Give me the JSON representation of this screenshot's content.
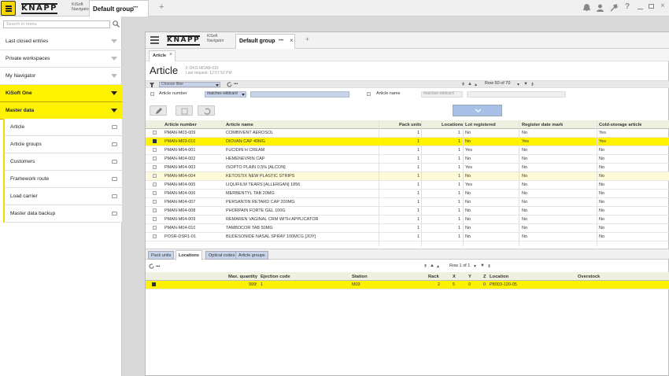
{
  "app": {
    "logo": "KNAPP",
    "product": "KiSoft",
    "product_sub": "Navigator",
    "tab_title": "Default group",
    "tab_more": "•••",
    "add_tab": "+"
  },
  "sidebar": {
    "search_placeholder": "Search in menu",
    "items": [
      {
        "label": "Last closed entries"
      },
      {
        "label": "Private workspaces"
      },
      {
        "label": "My Navigator"
      },
      {
        "label": "KiSoft One"
      },
      {
        "label": "Master data"
      }
    ],
    "children": [
      {
        "label": "Article"
      },
      {
        "label": "Article groups"
      },
      {
        "label": "Customers"
      },
      {
        "label": "Framework route"
      },
      {
        "label": "Load carrier"
      },
      {
        "label": "Master data backup"
      }
    ]
  },
  "inner": {
    "logo": "KNAPP",
    "product": "KiSoft",
    "product_sub": "Navigator",
    "tab_title": "Default group",
    "tab_more": "•••",
    "tab_close": "×",
    "add_tab": "+",
    "subtab": "Article",
    "subtab_close": "×",
    "page_title": "Article",
    "page_code": "F-DKG-MDAB-015",
    "last_request": "Last request: 12:57:52 PM",
    "filter_placeholder": "Choose filter",
    "more": "•••",
    "pager": "Row 50 of 70",
    "filter1_label": "Article number",
    "filter1_op": "matches wildcard",
    "filter2_label": "Article name",
    "filter2_op": "matches wildcard"
  },
  "table": {
    "headers": [
      "Article number",
      "Article name",
      "Pack units",
      "Locations",
      "Lot registered",
      "Register date mark",
      "Cold-storage article"
    ],
    "rows": [
      {
        "num": "PMAN-M03-009",
        "name": "COMBIVENT AEROSOL",
        "pack": "1",
        "loc": "1",
        "lot": "No",
        "reg": "No",
        "cold": "Yes",
        "checked": false,
        "style": ""
      },
      {
        "num": "PMAN-M03-010",
        "name": "DIOVAN CAP 40MG",
        "pack": "1",
        "loc": "1",
        "lot": "No",
        "reg": "Yes",
        "cold": "Yes",
        "checked": true,
        "style": "sel"
      },
      {
        "num": "PMAN-M04-001",
        "name": "FUCIDIN H CREAM",
        "pack": "1",
        "loc": "1",
        "lot": "Yes",
        "reg": "No",
        "cold": "No",
        "checked": false,
        "style": ""
      },
      {
        "num": "PMAN-M04-002",
        "name": "HEMENEVRIN CAP",
        "pack": "1",
        "loc": "1",
        "lot": "No",
        "reg": "No",
        "cold": "No",
        "checked": false,
        "style": ""
      },
      {
        "num": "PMAN-M04-003",
        "name": "ISOPTO PLAIN 0.5% [ALCON]",
        "pack": "1",
        "loc": "1",
        "lot": "Yes",
        "reg": "No",
        "cold": "No",
        "checked": false,
        "style": ""
      },
      {
        "num": "PMAN-M04-004",
        "name": "KETOSTIX NEW PLASTIC STRIPS",
        "pack": "1",
        "loc": "1",
        "lot": "No",
        "reg": "No",
        "cold": "No",
        "checked": false,
        "style": "lt"
      },
      {
        "num": "PMAN-M04-005",
        "name": "LIQUIFILM TEARS [ALLERGAN] 1856",
        "pack": "1",
        "loc": "1",
        "lot": "Yes",
        "reg": "No",
        "cold": "No",
        "checked": false,
        "style": ""
      },
      {
        "num": "PMAN-M04-006",
        "name": "MERBENTYL TAB 20MG",
        "pack": "1",
        "loc": "1",
        "lot": "No",
        "reg": "No",
        "cold": "No",
        "checked": false,
        "style": ""
      },
      {
        "num": "PMAN-M04-007",
        "name": "PERSANTIN RETARD CAP 200MG",
        "pack": "1",
        "loc": "1",
        "lot": "No",
        "reg": "No",
        "cold": "No",
        "checked": false,
        "style": ""
      },
      {
        "num": "PMAN-M04-008",
        "name": "PHORPAIN FORTE GEL 100G",
        "pack": "1",
        "loc": "1",
        "lot": "No",
        "reg": "No",
        "cold": "No",
        "checked": false,
        "style": ""
      },
      {
        "num": "PMAN-M04-009",
        "name": "REMAREN VAGINAL CRM WITH APPLICATOR",
        "pack": "1",
        "loc": "1",
        "lot": "No",
        "reg": "No",
        "cold": "No",
        "checked": false,
        "style": ""
      },
      {
        "num": "PMAN-M04-010",
        "name": "TAMBOCOR TAB 50MG",
        "pack": "1",
        "loc": "1",
        "lot": "No",
        "reg": "No",
        "cold": "No",
        "checked": false,
        "style": ""
      },
      {
        "num": "POSR-DSR1-01",
        "name": "BUDESONIDE NASAL SPRAY 100MCG [JOY]",
        "pack": "1",
        "loc": "1",
        "lot": "No",
        "reg": "No",
        "cold": "No",
        "checked": false,
        "style": ""
      }
    ]
  },
  "detail": {
    "tabs": [
      "Pack units",
      "Locations",
      "Optical codes",
      "Article groups"
    ],
    "pager": "Row 1 of 1",
    "more": "•••",
    "headers": [
      "Max. quantity",
      "Ejection code",
      "Station",
      "Rack",
      "X",
      "Y",
      "Z",
      "Location",
      "Overstock"
    ],
    "rows": [
      {
        "max": "9999",
        "ej": "1",
        "station": "M03",
        "rack": "2",
        "x": "5",
        "y": "0",
        "z": "0",
        "loc": "P8003-120-05",
        "over": ""
      }
    ]
  },
  "colors": {
    "accent": "#fff200",
    "link_field": "#c7d3e8"
  }
}
